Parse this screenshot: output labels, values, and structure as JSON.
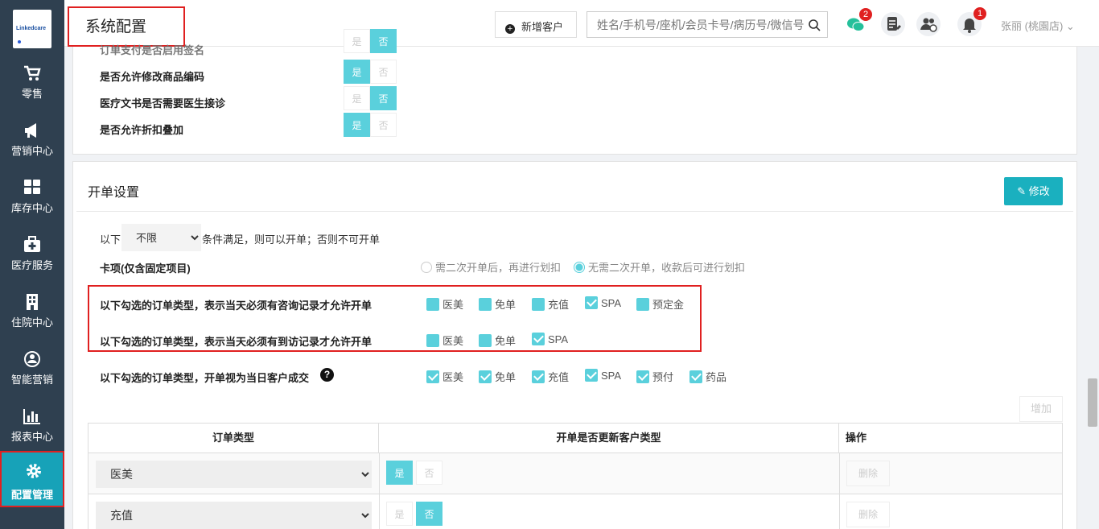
{
  "sidebar": {
    "logo_text": "Linkedcare",
    "items": [
      {
        "label": "零售",
        "icon": "cart-icon"
      },
      {
        "label": "营销中心",
        "icon": "megaphone-icon"
      },
      {
        "label": "库存中心",
        "icon": "grid-icon"
      },
      {
        "label": "医疗服务",
        "icon": "medical-kit-icon"
      },
      {
        "label": "住院中心",
        "icon": "building-icon"
      },
      {
        "label": "智能营销",
        "icon": "users-circle-icon"
      },
      {
        "label": "报表中心",
        "icon": "bar-chart-icon"
      },
      {
        "label": "配置管理",
        "icon": "gear-icon"
      }
    ]
  },
  "header": {
    "title": "系统配置",
    "add_customer": "新增客户",
    "search_placeholder": "姓名/手机号/座机/会员卡号/病历号/微信号",
    "wechat_badge": "2",
    "notif_badge": "1",
    "user": "张丽 (桃園店)"
  },
  "panel1": {
    "rows": [
      {
        "label": "订单支付是否启用签名",
        "value": "否"
      },
      {
        "label": "是否允许修改商品编码",
        "value": "是"
      },
      {
        "label": "医疗文书是否需要医生接诊",
        "value": "否"
      },
      {
        "label": "是否允许折扣叠加",
        "value": "是"
      }
    ],
    "yes": "是",
    "no": "否"
  },
  "panel2": {
    "title": "开单设置",
    "edit_label": "修改",
    "cond_prefix": "以下",
    "cond_select": "不限",
    "cond_suffix": "条件满足，则可以开单；否则不可开单",
    "card_label": "卡项(仅含固定项目)",
    "radio_a": "需二次开单后，再进行划扣",
    "radio_b": "无需二次开单，收款后可进行划扣",
    "consult_label": "以下勾选的订单类型，表示当天必须有咨询记录才允许开单",
    "consult_opts": [
      {
        "label": "医美",
        "checked": false
      },
      {
        "label": "免单",
        "checked": false
      },
      {
        "label": "充值",
        "checked": false
      },
      {
        "label": "SPA",
        "checked": true
      },
      {
        "label": "预定金",
        "checked": false
      }
    ],
    "visit_label": "以下勾选的订单类型，表示当天必须有到访记录才允许开单",
    "visit_opts": [
      {
        "label": "医美",
        "checked": false
      },
      {
        "label": "免单",
        "checked": false
      },
      {
        "label": "SPA",
        "checked": true
      }
    ],
    "deal_label": "以下勾选的订单类型，开单视为当日客户成交",
    "deal_opts": [
      {
        "label": "医美",
        "checked": true
      },
      {
        "label": "免单",
        "checked": true
      },
      {
        "label": "充值",
        "checked": true
      },
      {
        "label": "SPA",
        "checked": true
      },
      {
        "label": "预付",
        "checked": true
      },
      {
        "label": "药品",
        "checked": true
      }
    ],
    "add_label": "增加",
    "table": {
      "headers": [
        "订单类型",
        "开单是否更新客户类型",
        "操作"
      ],
      "rows": [
        {
          "type": "医美",
          "update": "是",
          "action": "删除"
        },
        {
          "type": "充值",
          "update": "否",
          "action": "删除"
        }
      ]
    }
  },
  "colors": {
    "accent": "#5ad0dc",
    "sidebar": "#2f4050",
    "highlight": "#e02020"
  }
}
